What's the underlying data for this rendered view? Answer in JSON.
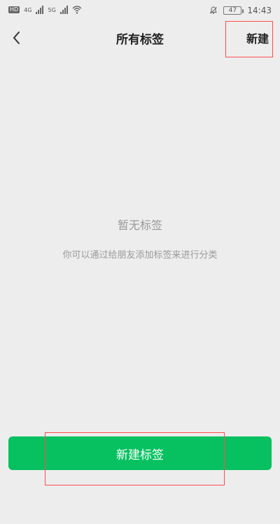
{
  "status_bar": {
    "network_left": "HD",
    "network_4g": "4G",
    "network_5g": "5G",
    "battery_level": "47",
    "time": "14:43"
  },
  "nav": {
    "title": "所有标签",
    "new_label": "新建",
    "back_icon": "chevron-left-icon"
  },
  "empty_state": {
    "title": "暂无标签",
    "description": "你可以通过给朋友添加标签来进行分类"
  },
  "primary_action": {
    "label": "新建标签"
  },
  "colors": {
    "background": "#ededed",
    "primary": "#07c160",
    "highlight": "#ff4d4f"
  }
}
